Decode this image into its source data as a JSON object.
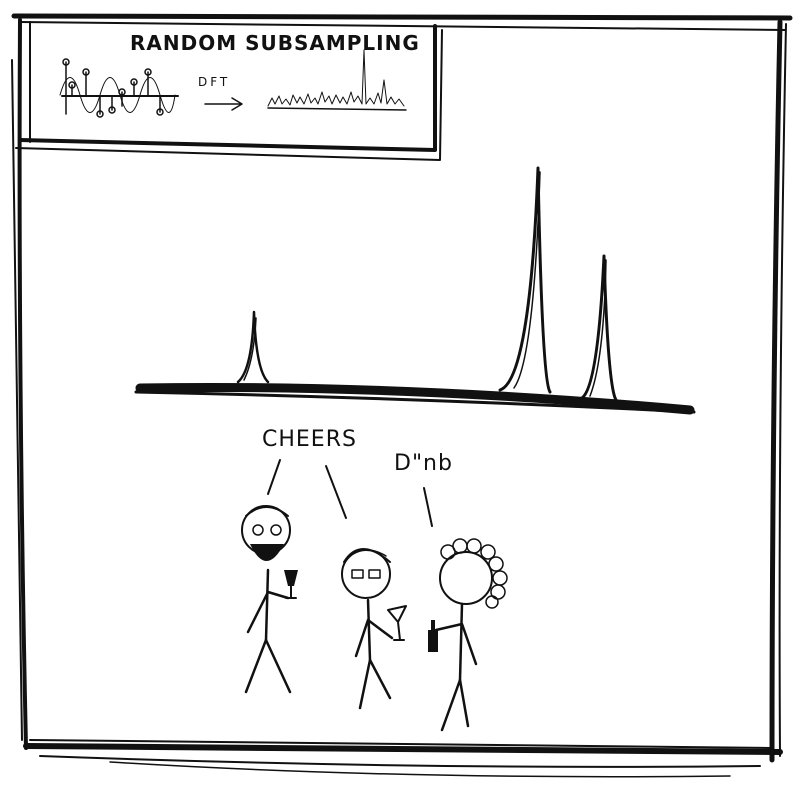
{
  "inset": {
    "title": "RANDOM SUBSAMPLING",
    "arrow_label": "DFT"
  },
  "speech": {
    "left": "CHEERS",
    "right": "D\"nb"
  },
  "colors": {
    "ink": "#111111",
    "paper": "#ffffff"
  }
}
